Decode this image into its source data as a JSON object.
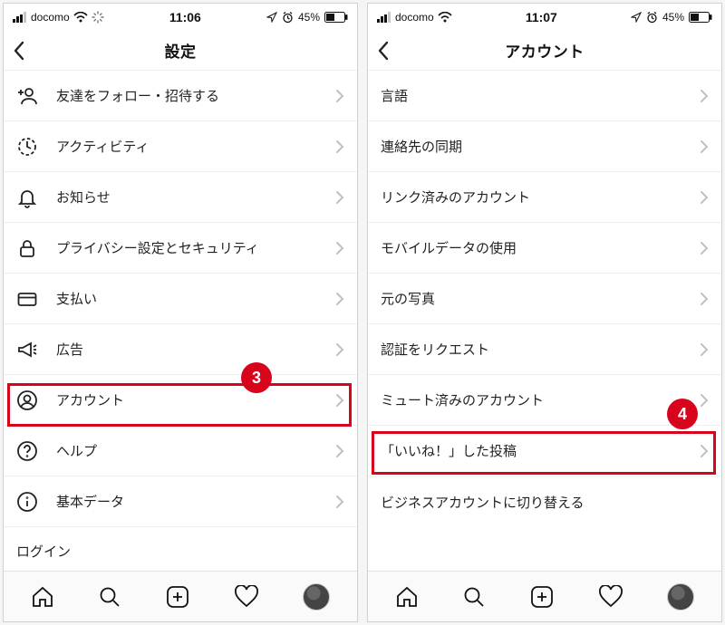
{
  "annotations": {
    "left_badge": "3",
    "right_badge": "4"
  },
  "left": {
    "status": {
      "carrier": "docomo",
      "time": "11:06",
      "battery": "45%"
    },
    "title": "設定",
    "items": [
      {
        "label": "友達をフォロー・招待する"
      },
      {
        "label": "アクティビティ"
      },
      {
        "label": "お知らせ"
      },
      {
        "label": "プライバシー設定とセキュリティ"
      },
      {
        "label": "支払い"
      },
      {
        "label": "広告"
      },
      {
        "label": "アカウント"
      },
      {
        "label": "ヘルプ"
      },
      {
        "label": "基本データ"
      }
    ],
    "cutoff_label": "ログイン"
  },
  "right": {
    "status": {
      "carrier": "docomo",
      "time": "11:07",
      "battery": "45%"
    },
    "title": "アカウント",
    "items": [
      {
        "label": "言語"
      },
      {
        "label": "連絡先の同期"
      },
      {
        "label": "リンク済みのアカウント"
      },
      {
        "label": "モバイルデータの使用"
      },
      {
        "label": "元の写真"
      },
      {
        "label": "認証をリクエスト"
      },
      {
        "label": "ミュート済みのアカウント"
      },
      {
        "label": "「いいね！」した投稿"
      }
    ],
    "link_label": "ビジネスアカウントに切り替える"
  }
}
